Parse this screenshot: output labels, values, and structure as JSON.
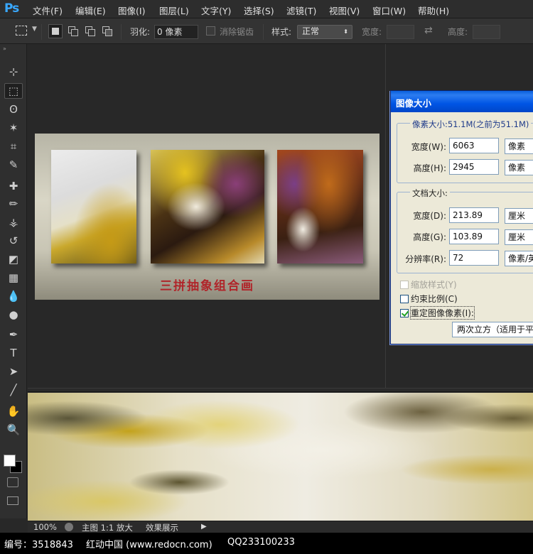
{
  "app": {
    "logo": "Ps"
  },
  "menu": [
    {
      "label": "文件(F)"
    },
    {
      "label": "编辑(E)"
    },
    {
      "label": "图像(I)"
    },
    {
      "label": "图层(L)"
    },
    {
      "label": "文字(Y)"
    },
    {
      "label": "选择(S)"
    },
    {
      "label": "滤镜(T)"
    },
    {
      "label": "视图(V)"
    },
    {
      "label": "窗口(W)"
    },
    {
      "label": "帮助(H)"
    }
  ],
  "options": {
    "feather_label": "羽化:",
    "feather_value": "0 像素",
    "antialias_label": "消除锯齿",
    "style_label": "样式:",
    "style_value": "正常",
    "width_label": "宽度:",
    "height_label": "高度:"
  },
  "tools": [
    {
      "icon": "move-tool-icon",
      "glyph": "⊹"
    },
    {
      "icon": "marquee-tool-icon",
      "glyph": "⬚"
    },
    {
      "icon": "lasso-tool-icon",
      "glyph": "ʘ"
    },
    {
      "icon": "magic-wand-icon",
      "glyph": "✶"
    },
    {
      "icon": "crop-tool-icon",
      "glyph": "⌗"
    },
    {
      "icon": "eyedropper-icon",
      "glyph": "✎"
    },
    {
      "icon": "healing-brush-icon",
      "glyph": "✚"
    },
    {
      "icon": "brush-tool-icon",
      "glyph": "✏"
    },
    {
      "icon": "clone-stamp-icon",
      "glyph": "⚶"
    },
    {
      "icon": "history-brush-icon",
      "glyph": "↺"
    },
    {
      "icon": "eraser-tool-icon",
      "glyph": "◩"
    },
    {
      "icon": "gradient-tool-icon",
      "glyph": "▦"
    },
    {
      "icon": "blur-tool-icon",
      "glyph": "💧"
    },
    {
      "icon": "dodge-tool-icon",
      "glyph": "●"
    },
    {
      "icon": "pen-tool-icon",
      "glyph": "✒"
    },
    {
      "icon": "type-tool-icon",
      "glyph": "T"
    },
    {
      "icon": "path-selection-icon",
      "glyph": "➤"
    },
    {
      "icon": "line-tool-icon",
      "glyph": "╱"
    },
    {
      "icon": "hand-tool-icon",
      "glyph": "✋"
    },
    {
      "icon": "zoom-tool-icon",
      "glyph": "🔍"
    }
  ],
  "canvas": {
    "caption": "三拼抽象组合画"
  },
  "status": {
    "zoom": "100%",
    "doc_name": "主图 1:1 放大",
    "effect": "效果展示"
  },
  "watermark": {
    "id": "编号：3518843",
    "site": "红动中国 (www.redocn.com)",
    "qq": "QQ233100233"
  },
  "dialog": {
    "title": "图像大小",
    "pixel_dims_label": "像素大小:51.1M(之前为51.1M)",
    "px_width_label": "宽度(W):",
    "px_width_value": "6063",
    "px_width_unit": "像素",
    "px_height_label": "高度(H):",
    "px_height_value": "2945",
    "px_height_unit": "像素",
    "doc_size_label": "文档大小:",
    "doc_width_label": "宽度(D):",
    "doc_width_value": "213.89",
    "doc_width_unit": "厘米",
    "doc_height_label": "高度(G):",
    "doc_height_value": "103.89",
    "doc_height_unit": "厘米",
    "resolution_label": "分辨率(R):",
    "resolution_value": "72",
    "resolution_unit": "像素/英寸",
    "scale_styles_label": "缩放样式(Y)",
    "constrain_label": "约束比例(C)",
    "resample_label": "重定图像像素(I):",
    "resample_method": "两次立方（适用于平滑渐变）"
  }
}
